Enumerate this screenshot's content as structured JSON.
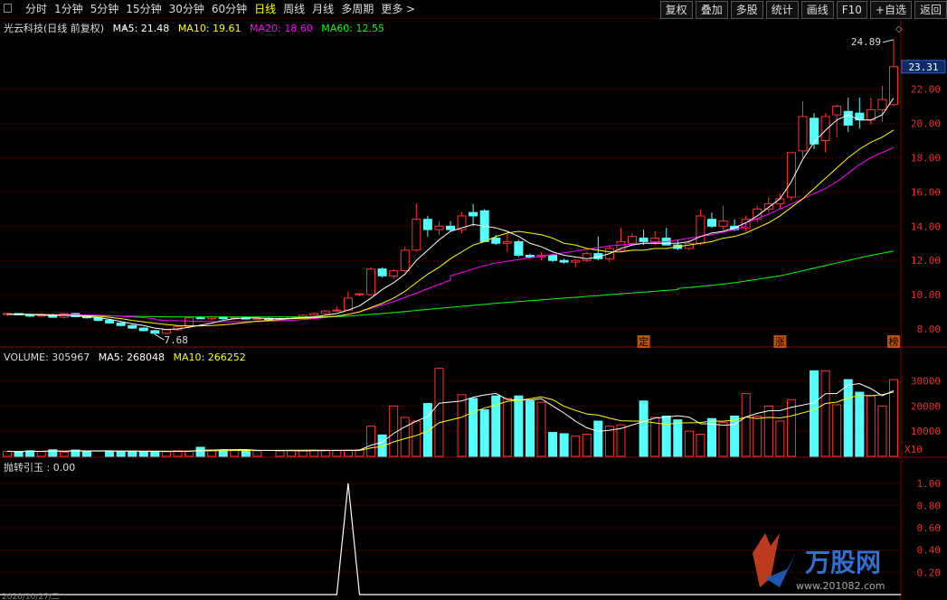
{
  "toolbar": {
    "periods": [
      "分时",
      "1分钟",
      "5分钟",
      "15分钟",
      "30分钟",
      "60分钟",
      "日线",
      "周线",
      "月线",
      "多周期",
      "更多 >"
    ],
    "active_period": "日线",
    "buttons": [
      "复权",
      "叠加",
      "多股",
      "统计",
      "画线",
      "F10",
      "+自选",
      "返回"
    ]
  },
  "main_info": {
    "title": "光云科技(日线 前复权)",
    "ma5": "MA5: 21.48",
    "ma10": "MA10: 19.61",
    "ma20": "MA20: 18.60",
    "ma60": "MA60: 12.55"
  },
  "volume_info": {
    "title": "VOLUME: 305967",
    "ma5": "MA5: 268048",
    "ma10": "MA10: 266252"
  },
  "indicator_info": {
    "title": "抛转引玉 : 0.00"
  },
  "price_axis": [
    "22.00",
    "20.00",
    "18.00",
    "16.00",
    "14.00",
    "12.00",
    "10.00",
    "8.00"
  ],
  "current_price": "23.31",
  "high_label": "24.89",
  "low_label": "7.68",
  "volume_axis": [
    "30000",
    "20000",
    "10000"
  ],
  "volume_unit": "X10",
  "indicator_axis": [
    "1.00",
    "0.80",
    "0.60",
    "0.40",
    "0.20"
  ],
  "markers": [
    "定",
    "涨",
    "榜"
  ],
  "watermark": {
    "brand": "万股网",
    "url": "www.201082.com"
  },
  "bottom_text": "2020/10/27/二",
  "colors": {
    "up": "#ff3232",
    "down": "#54ffff",
    "ma5": "#ffffff",
    "ma10": "#ffff00",
    "ma20": "#ff00ff",
    "ma60": "#00ff00",
    "grid": "#7a0000"
  },
  "chart_data": {
    "type": "candlestick",
    "candles": [
      [
        8.85,
        8.95,
        8.75,
        8.9
      ],
      [
        8.9,
        8.92,
        8.8,
        8.82
      ],
      [
        8.82,
        8.88,
        8.7,
        8.75
      ],
      [
        8.75,
        8.85,
        8.72,
        8.8
      ],
      [
        8.8,
        8.9,
        8.65,
        8.68
      ],
      [
        8.68,
        8.95,
        8.6,
        8.9
      ],
      [
        8.9,
        8.95,
        8.7,
        8.72
      ],
      [
        8.72,
        8.8,
        8.6,
        8.65
      ],
      [
        8.65,
        8.7,
        8.45,
        8.5
      ],
      [
        8.5,
        8.55,
        8.3,
        8.35
      ],
      [
        8.35,
        8.4,
        8.15,
        8.2
      ],
      [
        8.2,
        8.25,
        8.0,
        8.05
      ],
      [
        8.05,
        8.1,
        7.85,
        7.9
      ],
      [
        7.9,
        7.95,
        7.68,
        7.75
      ],
      [
        7.75,
        8.0,
        7.7,
        7.95
      ],
      [
        7.95,
        8.2,
        7.9,
        8.15
      ],
      [
        8.15,
        8.7,
        8.1,
        8.65
      ],
      [
        8.65,
        8.75,
        8.55,
        8.6
      ],
      [
        8.6,
        8.75,
        8.5,
        8.7
      ],
      [
        8.7,
        8.75,
        8.55,
        8.6
      ],
      [
        8.6,
        8.7,
        8.5,
        8.65
      ],
      [
        8.65,
        8.72,
        8.55,
        8.58
      ],
      [
        8.58,
        8.7,
        8.5,
        8.62
      ],
      [
        8.62,
        8.7,
        8.52,
        8.55
      ],
      [
        8.55,
        8.68,
        8.5,
        8.6
      ],
      [
        8.6,
        8.75,
        8.55,
        8.7
      ],
      [
        8.7,
        8.85,
        8.65,
        8.8
      ],
      [
        8.8,
        8.95,
        8.75,
        8.9
      ],
      [
        8.9,
        9.1,
        8.85,
        9.05
      ],
      [
        9.05,
        9.3,
        9.0,
        9.1
      ],
      [
        9.1,
        10.2,
        9.05,
        9.8
      ],
      [
        10.0,
        10.1,
        9.9,
        10.05
      ],
      [
        10.0,
        11.6,
        9.95,
        11.5
      ],
      [
        11.5,
        11.6,
        11.0,
        11.1
      ],
      [
        11.1,
        11.5,
        10.9,
        11.4
      ],
      [
        11.4,
        12.8,
        11.3,
        12.6
      ],
      [
        12.6,
        15.3,
        12.5,
        14.4
      ],
      [
        14.4,
        14.6,
        13.4,
        13.8
      ],
      [
        13.8,
        14.3,
        13.5,
        14.0
      ],
      [
        14.0,
        14.3,
        13.7,
        13.8
      ],
      [
        13.8,
        14.8,
        13.6,
        14.6
      ],
      [
        14.8,
        15.3,
        14.0,
        14.6
      ],
      [
        14.9,
        15.0,
        13.1,
        13.1
      ],
      [
        13.3,
        13.5,
        12.9,
        13.0
      ],
      [
        13.0,
        13.6,
        12.5,
        13.1
      ],
      [
        13.1,
        13.2,
        12.2,
        12.3
      ],
      [
        12.3,
        12.4,
        12.1,
        12.2
      ],
      [
        12.2,
        12.5,
        12.0,
        12.3
      ],
      [
        12.3,
        12.4,
        11.9,
        12.0
      ],
      [
        12.0,
        12.1,
        11.8,
        11.9
      ],
      [
        11.9,
        12.1,
        11.6,
        12.0
      ],
      [
        12.0,
        12.5,
        11.9,
        12.4
      ],
      [
        12.4,
        13.4,
        12.0,
        12.1
      ],
      [
        12.1,
        12.9,
        11.9,
        12.7
      ],
      [
        12.6,
        13.9,
        12.5,
        13.1
      ],
      [
        13.0,
        13.6,
        12.9,
        13.4
      ],
      [
        13.3,
        13.8,
        12.9,
        13.1
      ],
      [
        13.1,
        13.7,
        12.9,
        13.3
      ],
      [
        13.3,
        13.9,
        13.1,
        12.9
      ],
      [
        12.9,
        13.2,
        12.6,
        12.7
      ],
      [
        12.7,
        13.2,
        12.6,
        13.0
      ],
      [
        13.0,
        15.0,
        12.9,
        14.6
      ],
      [
        14.4,
        14.8,
        13.9,
        14.0
      ],
      [
        14.0,
        15.2,
        13.8,
        14.3
      ],
      [
        14.0,
        14.4,
        13.7,
        13.8
      ],
      [
        13.9,
        14.6,
        13.7,
        14.4
      ],
      [
        14.4,
        15.2,
        14.2,
        15.0
      ],
      [
        15.0,
        15.7,
        14.8,
        15.3
      ],
      [
        15.3,
        15.9,
        15.0,
        15.6
      ],
      [
        15.7,
        18.3,
        15.5,
        18.3
      ],
      [
        18.4,
        21.3,
        18.0,
        20.4
      ],
      [
        20.3,
        20.6,
        18.5,
        18.8
      ],
      [
        19.0,
        20.6,
        18.3,
        20.4
      ],
      [
        20.5,
        21.1,
        19.2,
        21.0
      ],
      [
        20.7,
        21.5,
        19.5,
        19.9
      ],
      [
        20.6,
        21.5,
        19.7,
        20.2
      ],
      [
        20.2,
        21.5,
        19.9,
        20.8
      ],
      [
        20.8,
        22.2,
        20.1,
        21.4
      ],
      [
        21.1,
        24.89,
        21.0,
        23.31
      ]
    ],
    "volume": [
      2000,
      1800,
      2200,
      1900,
      2600,
      1700,
      2500,
      2000,
      2100,
      2000,
      1900,
      1900,
      2000,
      1900,
      2200,
      2100,
      3600,
      2500,
      2600,
      2400,
      2300,
      2200,
      2100,
      2300,
      2200,
      2400,
      2500,
      2400,
      2500,
      2600,
      12000,
      8500,
      20000,
      15500,
      14000,
      21000,
      35000,
      24500,
      23000,
      18500,
      24000,
      23000,
      24000,
      22000,
      21500,
      9500,
      9000,
      8000,
      8800,
      14000,
      12000,
      12500,
      22000,
      15500,
      16000,
      14500,
      10000,
      8800,
      15000,
      13500,
      16000,
      25000,
      16000,
      20000,
      14000,
      22500,
      34000,
      34000,
      20500,
      30500,
      25500,
      24000,
      20000,
      30500
    ],
    "ma5": [
      8.85,
      8.87,
      8.84,
      8.82,
      8.79,
      8.81,
      8.77,
      8.72,
      8.66,
      8.56,
      8.44,
      8.3,
      8.2,
      8.05,
      7.97,
      8.0,
      8.1,
      8.22,
      8.34,
      8.5,
      8.6,
      8.64,
      8.64,
      8.6,
      8.6,
      8.62,
      8.66,
      8.7,
      8.8,
      8.9,
      9.1,
      9.35,
      9.8,
      10.3,
      10.7,
      11.2,
      12.0,
      12.6,
      13.2,
      13.7,
      13.9,
      14.1,
      14.0,
      13.9,
      13.7,
      13.4,
      13.0,
      12.8,
      12.5,
      12.3,
      12.2,
      12.1,
      12.2,
      12.4,
      12.7,
      12.9,
      13.0,
      13.0,
      13.0,
      13.0,
      13.1,
      13.4,
      13.6,
      13.7,
      13.9,
      14.2,
      14.6,
      15.1,
      15.6,
      16.6,
      17.9,
      18.9,
      19.6,
      20.2,
      20.5,
      20.2,
      20.2,
      20.5,
      21.48
    ],
    "ma10": [
      8.85,
      8.86,
      8.85,
      8.84,
      8.82,
      8.8,
      8.79,
      8.77,
      8.74,
      8.68,
      8.6,
      8.5,
      8.42,
      8.33,
      8.26,
      8.2,
      8.18,
      8.18,
      8.2,
      8.24,
      8.3,
      8.38,
      8.45,
      8.5,
      8.55,
      8.6,
      8.62,
      8.65,
      8.7,
      8.75,
      8.85,
      9.0,
      9.25,
      9.5,
      9.8,
      10.2,
      10.7,
      11.2,
      11.6,
      12.1,
      12.5,
      12.9,
      13.1,
      13.4,
      13.6,
      13.7,
      13.6,
      13.5,
      13.3,
      13.0,
      12.9,
      12.7,
      12.6,
      12.5,
      12.5,
      12.6,
      12.6,
      12.7,
      12.7,
      12.8,
      12.9,
      13.0,
      13.1,
      13.3,
      13.4,
      13.6,
      13.9,
      14.2,
      14.6,
      15.1,
      15.6,
      16.2,
      16.8,
      17.4,
      18.0,
      18.5,
      18.9,
      19.2,
      19.61
    ],
    "ma20": [
      8.85,
      8.85,
      8.85,
      8.85,
      8.84,
      8.84,
      8.83,
      8.82,
      8.8,
      8.78,
      8.74,
      8.7,
      8.66,
      8.6,
      8.55,
      8.5,
      8.48,
      8.46,
      8.44,
      8.43,
      8.42,
      8.42,
      8.43,
      8.44,
      8.46,
      8.48,
      8.5,
      8.55,
      8.6,
      8.67,
      8.75,
      8.85,
      9.0,
      9.2,
      9.4,
      9.6,
      9.85,
      10.1,
      10.35,
      10.6,
      10.85,
      11.1,
      11.3,
      11.5,
      11.7,
      11.85,
      11.95,
      12.05,
      12.15,
      12.25,
      12.35,
      12.45,
      12.55,
      12.65,
      12.75,
      12.85,
      12.9,
      12.95,
      13.0,
      13.05,
      13.1,
      13.2,
      13.3,
      13.4,
      13.5,
      13.65,
      13.8,
      14.0,
      14.2,
      14.45,
      14.7,
      15.0,
      15.3,
      15.6,
      15.9,
      16.2,
      16.6,
      17.1,
      17.6,
      18.0,
      18.3,
      18.6
    ],
    "ma60": [
      8.85,
      8.84,
      8.83,
      8.82,
      8.81,
      8.8,
      8.79,
      8.78,
      8.77,
      8.76,
      8.75,
      8.74,
      8.73,
      8.72,
      8.71,
      8.7,
      8.7,
      8.7,
      8.7,
      8.7,
      8.7,
      8.7,
      8.7,
      8.7,
      8.7,
      8.7,
      8.7,
      8.7,
      8.7,
      8.7,
      8.72,
      8.75,
      8.8,
      8.85,
      8.9,
      8.96,
      9.02,
      9.08,
      9.14,
      9.2,
      9.26,
      9.32,
      9.38,
      9.44,
      9.5,
      9.55,
      9.6,
      9.65,
      9.7,
      9.75,
      9.8,
      9.85,
      9.9,
      9.95,
      10.0,
      10.05,
      10.1,
      10.15,
      10.2,
      10.25,
      10.3,
      10.36,
      10.42,
      10.48,
      10.55,
      10.62,
      10.7,
      10.8,
      10.9,
      11.0,
      11.1,
      11.25,
      11.4,
      11.55,
      11.7,
      11.85,
      12.0,
      12.15,
      12.3,
      12.42,
      12.55
    ],
    "indicator": [
      0,
      0,
      0,
      0,
      0,
      0,
      0,
      0,
      0,
      0,
      0,
      0,
      0,
      0,
      0,
      0,
      0,
      0,
      0,
      0,
      0,
      0,
      0,
      0,
      0,
      0,
      0,
      0,
      0,
      0,
      0,
      0,
      0,
      0,
      0,
      0,
      0,
      0,
      0,
      0,
      0,
      0,
      0,
      0,
      0,
      0,
      0,
      0,
      0,
      0,
      0,
      0,
      0,
      0,
      0,
      0,
      0,
      0,
      0,
      0,
      0,
      0,
      0,
      0,
      0,
      0,
      0,
      0,
      0,
      0,
      0,
      0,
      0,
      0,
      0,
      0,
      0,
      0,
      0
    ],
    "indicator_spike_index": 30,
    "indicator_spike_value": 1.0
  }
}
